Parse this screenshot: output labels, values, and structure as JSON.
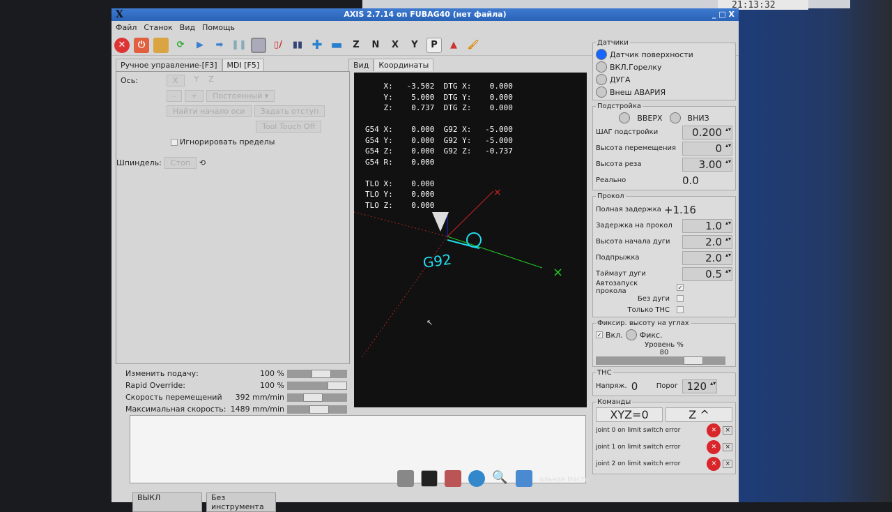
{
  "window": {
    "title": "AXIS 2.7.14 on FUBAG40 (нет файла)",
    "controls": "_ □ X"
  },
  "clock": "21:13:32",
  "menu": [
    "Файл",
    "Станок",
    "Вид",
    "Помощь"
  ],
  "toolbar": [
    "estop-icon",
    "power-icon",
    "open-icon",
    "reload-icon",
    "run-icon",
    "step-icon",
    "pause-icon",
    "stop-icon",
    "block-delete-icon",
    "optional-stop-icon",
    "zoom-in-icon",
    "zoom-out-icon",
    "view-z-icon",
    "view-z2-icon",
    "view-x-icon",
    "view-y-icon",
    "view-p-icon",
    "rotate-icon",
    "clear-icon"
  ],
  "toolbar_labels": {
    "z": "Z",
    "z2": "N",
    "x": "X",
    "y": "Y",
    "p": "P"
  },
  "left": {
    "tabs": [
      "Ручное управление-[F3]",
      "MDI [F5]"
    ],
    "axis_label": "Ось:",
    "axes": [
      "X",
      "Y",
      "Z"
    ],
    "jog_minus": "-",
    "jog_plus": "+",
    "jog_mode": "Постоянный",
    "home_button": "Найти начало оси",
    "offset_button": "Задать отступ",
    "touch_off_button": "Tool Touch Off",
    "ignore_limits": "Игнорировать пределы",
    "spindle_label": "Шпиндель:",
    "spindle_stop": "Стоп"
  },
  "overrides": [
    {
      "label": "Изменить подачу:",
      "value": "100 %",
      "level": 0.6
    },
    {
      "label": "Rapid Override:",
      "value": "100 %",
      "level": 1.0
    },
    {
      "label": "Скорость перемещений",
      "value": "392 mm/min",
      "level": 0.4
    },
    {
      "label": "Максимальная скорость:",
      "value": "1489 mm/min",
      "level": 0.55
    }
  ],
  "status": {
    "machine": "ВЫКЛ",
    "tool": "Без инструмента"
  },
  "view": {
    "tabs": [
      "Вид",
      "Координаты"
    ],
    "dro": [
      "    X:   -3.502  DTG X:    0.000",
      "    Y:    5.000  DTG Y:    0.000",
      "    Z:    0.737  DTG Z:    0.000",
      "",
      "G54 X:    0.000  G92 X:   -5.000",
      "G54 Y:    0.000  G92 Y:   -5.000",
      "G54 Z:    0.000  G92 Z:   -0.737",
      "G54 R:    0.000",
      "",
      "TLO X:    0.000",
      "TLO Y:    0.000",
      "TLO Z:    0.000"
    ],
    "g92_label": "G92"
  },
  "sensors": {
    "legend": "Датчики",
    "items": [
      {
        "label": "Датчик поверхности",
        "on": true
      },
      {
        "label": "ВКЛ.Горелку",
        "on": false
      },
      {
        "label": "ДУГА",
        "on": false
      },
      {
        "label": "Внеш АВАРИЯ",
        "on": false
      }
    ]
  },
  "tuning": {
    "legend": "Подстройка",
    "up": "ВВЕРХ",
    "down": "ВНИЗ",
    "step_label": "ШАГ подстройки",
    "step": "0.200",
    "travel_label": "Высота перемещения",
    "travel": "0",
    "cut_label": "Высота реза",
    "cut": "3.00",
    "real_label": "Реально",
    "real": "0.0"
  },
  "pierce": {
    "legend": "Прокол",
    "total_label": "Полная задержка",
    "total": "+1.16",
    "fields": [
      {
        "label": "Задержка на прокол",
        "value": "1.0"
      },
      {
        "label": "Высота начала дуги",
        "value": "2.0"
      },
      {
        "label": "Подпрыжка",
        "value": "2.0"
      },
      {
        "label": "Таймаут дуги",
        "value": "0.5"
      }
    ],
    "checks": [
      {
        "label": "Автозапуск прокола",
        "checked": true
      },
      {
        "label": "Без дуги",
        "checked": false
      },
      {
        "label": "Только THC",
        "checked": false
      }
    ]
  },
  "corner": {
    "legend": "Фиксир. высоту на углах",
    "enable": "Вкл.",
    "fix": "Фикс.",
    "level_label": "Уровень %",
    "level": "80"
  },
  "thc": {
    "legend": "THC",
    "volt_label": "Напряж.",
    "volt": "0",
    "threshold_label": "Порог",
    "threshold": "120"
  },
  "commands": {
    "legend": "Команды",
    "xyz0": "XYZ=0",
    "zup": "Z ^"
  },
  "errors": [
    "joint 0 on limit switch error",
    "joint 1 on limit switch error",
    "joint 2 on limit switch error"
  ],
  "taskbar_partial": "альная Насто",
  "colors": {
    "title": "#2a63b8",
    "led_on": "#1565ff",
    "error": "#d9262b"
  }
}
